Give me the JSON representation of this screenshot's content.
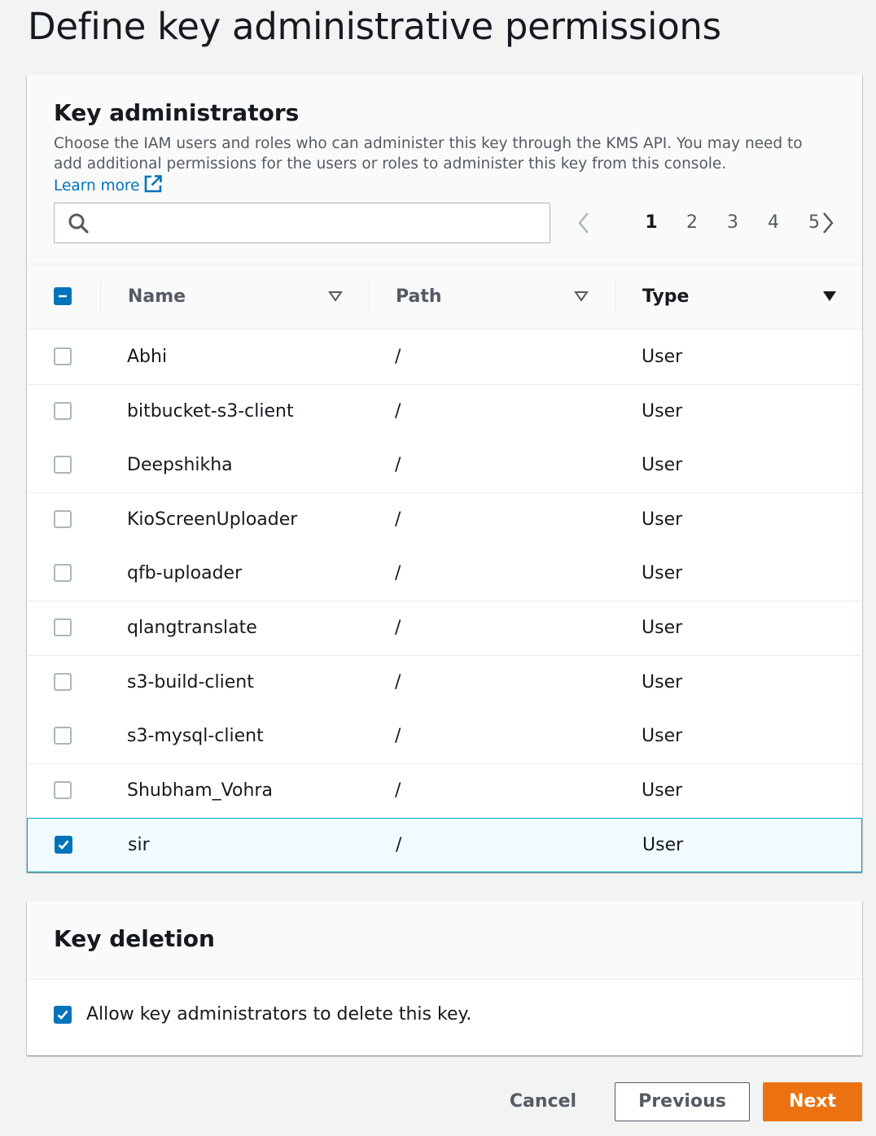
{
  "page": {
    "title": "Define key administrative permissions"
  },
  "key_administrators": {
    "title": "Key administrators",
    "description": "Choose the IAM users and roles who can administer this key through the KMS API. You may need to add additional permissions for the users or roles to administer this key from this console.",
    "learn_more": "Learn more",
    "search": {
      "value": "",
      "placeholder": ""
    },
    "pagination": {
      "current": "1",
      "pages": [
        "1",
        "2",
        "3",
        "4",
        "5"
      ]
    },
    "columns": {
      "name": "Name",
      "path": "Path",
      "type": "Type"
    },
    "select_all_state": "indeterminate",
    "rows": [
      {
        "name": "Abhi",
        "path": "/",
        "type": "User",
        "checked": false
      },
      {
        "name": "bitbucket-s3-client",
        "path": "/",
        "type": "User",
        "checked": false
      },
      {
        "name": "Deepshikha",
        "path": "/",
        "type": "User",
        "checked": false
      },
      {
        "name": "KioScreenUploader",
        "path": "/",
        "type": "User",
        "checked": false
      },
      {
        "name": "qfb-uploader",
        "path": "/",
        "type": "User",
        "checked": false
      },
      {
        "name": "qlangtranslate",
        "path": "/",
        "type": "User",
        "checked": false
      },
      {
        "name": "s3-build-client",
        "path": "/",
        "type": "User",
        "checked": false
      },
      {
        "name": "s3-mysql-client",
        "path": "/",
        "type": "User",
        "checked": false
      },
      {
        "name": "Shubham_Vohra",
        "path": "/",
        "type": "User",
        "checked": false
      },
      {
        "name": "sir",
        "path": "/",
        "type": "User",
        "checked": true
      }
    ]
  },
  "key_deletion": {
    "title": "Key deletion",
    "allow_delete_label": "Allow key administrators to delete this key.",
    "allow_delete_checked": true
  },
  "footer": {
    "cancel": "Cancel",
    "previous": "Previous",
    "next": "Next"
  },
  "colors": {
    "accent": "#0073bb",
    "primary_button": "#ec7211",
    "selected_row": "#f1faff"
  }
}
